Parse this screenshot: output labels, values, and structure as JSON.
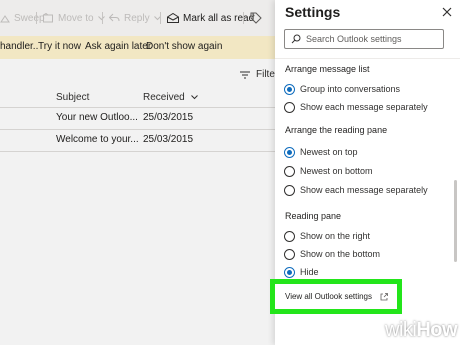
{
  "toolbar": {
    "sweep_label": "Sweep",
    "move_label": "Move to",
    "reply_label": "Reply",
    "mark_all_label": "Mark all as read"
  },
  "banner": {
    "prefix_text": "handler..",
    "try_now": "Try it now",
    "ask_later": "Ask again later",
    "dont_show": "Don't show again"
  },
  "list": {
    "filter_label": "Filter",
    "subject_header": "Subject",
    "received_header": "Received",
    "rows": [
      {
        "subject": "Your new Outloo...",
        "received": "25/03/2015"
      },
      {
        "subject": "Welcome to your...",
        "received": "25/03/2015"
      }
    ]
  },
  "settings": {
    "title": "Settings",
    "search_placeholder": "Search Outlook settings",
    "message_list": {
      "heading": "Arrange message list",
      "options": [
        "Group into conversations",
        "Show each message separately"
      ],
      "selected": 0
    },
    "reading_pane_order": {
      "heading": "Arrange the reading pane",
      "options": [
        "Newest on top",
        "Newest on bottom",
        "Show each message separately"
      ],
      "selected": 0
    },
    "reading_pane": {
      "heading": "Reading pane",
      "options": [
        "Show on the right",
        "Show on the bottom",
        "Hide"
      ],
      "selected": 2
    },
    "view_all_label": "View all Outlook settings"
  },
  "watermark": {
    "part1": "wiki",
    "part2": "How"
  },
  "colors": {
    "accent": "#0f6cbd",
    "highlight": "#23e51a",
    "banner": "#fff4ce"
  }
}
